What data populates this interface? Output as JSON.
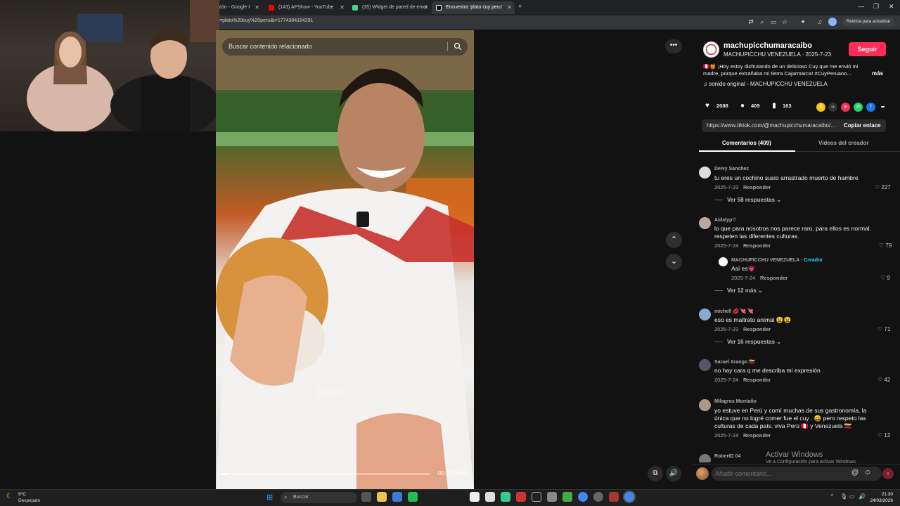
{
  "browser": {
    "tabs": [
      {
        "label": "razón - Google I",
        "color": "#4285f4"
      },
      {
        "label": "(143) APShow - YouTube",
        "color": "#ff0000"
      },
      {
        "label": "(35) Widget de pared de emot",
        "color": "#3ddc84"
      },
      {
        "label": "Encuentra 'plato cuy peru'",
        "color": "#111111"
      }
    ],
    "new_tab": "+",
    "url": "=plato%20cuy%20peru&t=1774384164291",
    "update_button": "Reinicia para actualizar"
  },
  "video": {
    "search_placeholder": "Buscar contenido relacionado",
    "timecode": "00:01/00:48",
    "overlay_text": "buen",
    "progress": 0.03,
    "more_label": "•••",
    "up_label": "⌃",
    "down_label": "⌄"
  },
  "post": {
    "author": "machupicchumaracaibo",
    "author_sub": "MACHUPICCHU VENEZUELA · 2025-7-23",
    "follow": "Seguir",
    "description": "🇵🇪🍯 ¡Hoy estoy disfrutando de un delicioso Cuy que me envió mi madre, porque extrañaba mi tierra Cajarmarca! #CuyPeruano...",
    "more": "más",
    "music": "♫  sonido original - MACHUPICCHU VENEZUELA",
    "likes": "2088",
    "comments": "409",
    "saves": "163",
    "link": "https://www.tiktok.com/@machupicchumaracaibo/...",
    "copy_link": "Copiar enlace",
    "tab_comments": "Comentarios (409)",
    "tab_creator": "Videos del creador"
  },
  "comments": [
    {
      "name": "Deivy Sanchez",
      "text": "tu eres un cochino susio arrastrado muerto de hambre",
      "date": "2025-7-23",
      "reply": "Responder",
      "likes": "♡ 227",
      "more": "Ver 58 respuestas ⌄"
    },
    {
      "name": "Aidalyp♡",
      "text": "lo que para nosotros nos parece raro, para ellos es normal. respeten las diferentes culturas.",
      "date": "2025-7-24",
      "reply": "Responder",
      "likes": "♡ 79",
      "sub": {
        "name": "MACHUPICCHU VENEZUELA · ",
        "badge": "Creador",
        "text": "Así es💗",
        "date": "2025-7-24",
        "reply": "Responder",
        "likes": "♡ 9"
      },
      "more": "Ver 12 más ⌄"
    },
    {
      "name": "michell 💋 💘 💘",
      "text": "eso es maltrato animal 😩😩",
      "date": "2025-7-23",
      "reply": "Responder",
      "likes": "♡ 71",
      "more": "Ver 16 respuestas ⌄"
    },
    {
      "name": "Sarael Arango 🇻🇪",
      "text": "no hay cara q me describa mi expresión",
      "date": "2025-7-24",
      "reply": "Responder",
      "likes": "♡ 42"
    },
    {
      "name": "Milagros Montaño",
      "text": "yo estuve en Perú y comí muchas de sus gastronomía, la única que no logré comer fue el cuy . 😝 pero respeto las culturas de cada país. viva Perú 🇵🇪 y Venezuela 🇻🇪",
      "date": "2025-7-24",
      "reply": "Responder",
      "likes": "♡ 12"
    },
    {
      "name": "RobertD 04"
    }
  ],
  "comment_input": {
    "placeholder": "Añadir comentario..."
  },
  "watermark": {
    "title": "Activar Windows",
    "sub": "Ve a Configuración para activar Windows."
  },
  "taskbar": {
    "temp": "9°C",
    "weather": "Despejado",
    "search": "Buscar",
    "time": "21:30",
    "date": "24/03/2026"
  },
  "colors": {
    "accent": "#fe2c55",
    "creator_badge": "#20d5ec"
  }
}
